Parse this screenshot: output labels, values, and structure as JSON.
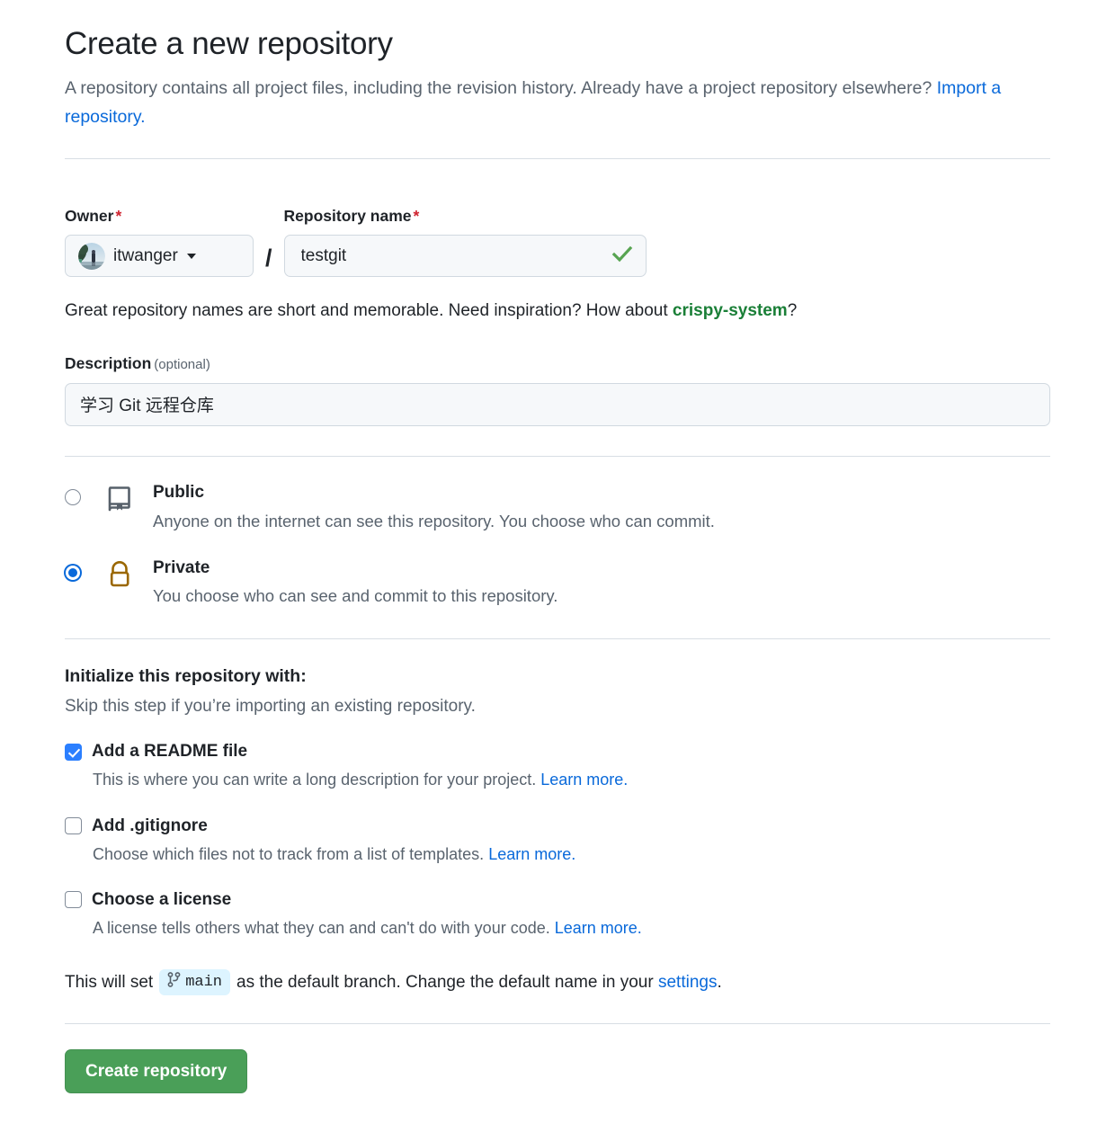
{
  "header": {
    "title": "Create a new repository",
    "subtitle_before": "A repository contains all project files, including the revision history. Already have a project repository elsewhere? ",
    "import_link": "Import a repository."
  },
  "owner": {
    "label": "Owner",
    "required_mark": "*",
    "name": "itwanger",
    "avatar_alt": "user-avatar"
  },
  "repository": {
    "label": "Repository name",
    "required_mark": "*",
    "value": "testgit",
    "placeholder": "",
    "valid_icon": "check-icon"
  },
  "separator": "/",
  "hint": {
    "before": "Great repository names are short and memorable. Need inspiration? How about ",
    "suggestion": "crispy-system",
    "after": "?"
  },
  "description": {
    "label": "Description",
    "optional": "(optional)",
    "value": "学习 Git 远程仓库",
    "placeholder": ""
  },
  "visibility": {
    "options": [
      {
        "id": "public",
        "title": "Public",
        "desc": "Anyone on the internet can see this repository. You choose who can commit.",
        "icon": "book-icon",
        "selected": false
      },
      {
        "id": "private",
        "title": "Private",
        "desc": "You choose who can see and commit to this repository.",
        "icon": "lock-icon",
        "selected": true
      }
    ]
  },
  "initialize": {
    "title": "Initialize this repository with:",
    "subtitle": "Skip this step if you’re importing an existing repository.",
    "items": [
      {
        "id": "readme",
        "label": "Add a README file",
        "desc_before": "This is where you can write a long description for your project. ",
        "learn_more": "Learn more.",
        "checked": true
      },
      {
        "id": "gitignore",
        "label": "Add .gitignore",
        "desc_before": "Choose which files not to track from a list of templates. ",
        "learn_more": "Learn more.",
        "checked": false
      },
      {
        "id": "license",
        "label": "Choose a license",
        "desc_before": "A license tells others what they can and can't do with your code. ",
        "learn_more": "Learn more.",
        "checked": false
      }
    ]
  },
  "branch": {
    "before": "This will set",
    "name": "main",
    "middle": "as the default branch. Change the default name in your",
    "settings_link": "settings",
    "after": "."
  },
  "submit": {
    "label": "Create repository"
  },
  "colors": {
    "link": "#0969da",
    "suggestion_green": "#1a7f37",
    "required_red": "#cf222e",
    "lock_brown": "#9a6700",
    "book_gray": "#57606a",
    "checkbox_blue": "#2b7fff",
    "radio_blue": "#0969da",
    "button_green": "#4a9f58",
    "badge_blue_bg": "#ddf4ff",
    "divider": "#d8dee4",
    "input_bg": "#f6f8fa",
    "check_green": "#57a451"
  }
}
